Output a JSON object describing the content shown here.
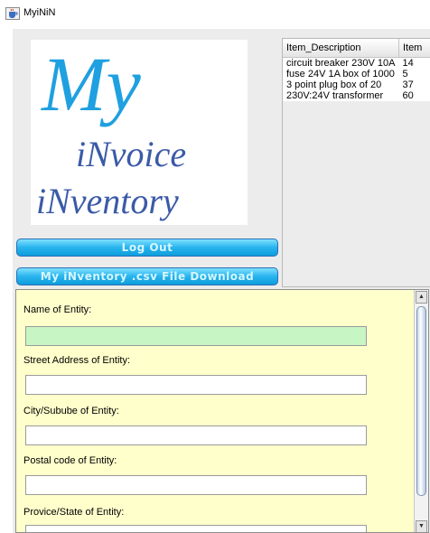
{
  "window": {
    "title": "MyiNiN",
    "icon": "java-cup-icon"
  },
  "logo": {
    "line1": "My",
    "line2": "iNvoice",
    "line3": "iNventory",
    "colors": {
      "my": "#1fa0e0",
      "invoice": "#3b5aa8",
      "inventory": "#3b5aa8"
    }
  },
  "buttons": {
    "logout": "Log Out",
    "download": "My iNventory .csv File Download"
  },
  "inventory_table": {
    "columns": [
      "Item_Description",
      "Item"
    ],
    "rows": [
      [
        "circuit breaker 230V 10A",
        "14"
      ],
      [
        "fuse  24V 1A box of 1000",
        "5"
      ],
      [
        "3 point plug box of 20",
        "37"
      ],
      [
        "230V:24V transformer",
        "60"
      ]
    ]
  },
  "form": {
    "fields": [
      {
        "label": "Name of Entity:",
        "value": "",
        "active": true
      },
      {
        "label": "Street Address of Entity:",
        "value": "",
        "active": false
      },
      {
        "label": "City/Subube of Entity:",
        "value": "",
        "active": false
      },
      {
        "label": "Postal code of Entity:",
        "value": "",
        "active": false
      },
      {
        "label": "Provice/State of Entity:",
        "value": "",
        "active": false
      }
    ]
  },
  "colors": {
    "form_bg": "#ffffcc",
    "active_field": "#c8f5c4",
    "button_gradient": "#27b4ee"
  }
}
